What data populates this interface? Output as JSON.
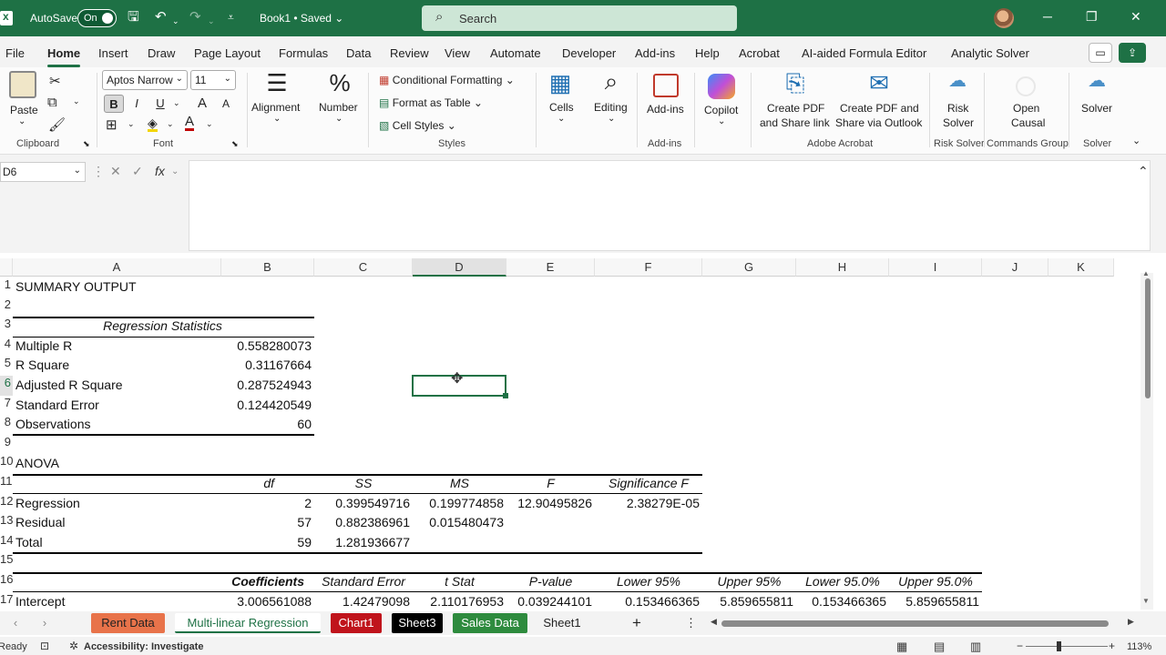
{
  "titlebar": {
    "autosave_label": "AutoSave",
    "toggle_label": "On",
    "doc_title": "Book1 • Saved",
    "search_placeholder": "Search",
    "minimize": "─",
    "restore": "❐",
    "close": "✕"
  },
  "menu": {
    "items": [
      "File",
      "Home",
      "Insert",
      "Draw",
      "Page Layout",
      "Formulas",
      "Data",
      "Review",
      "View",
      "Automate",
      "Developer",
      "Add-ins",
      "Help",
      "Acrobat",
      "AI-aided Formula Editor",
      "Analytic Solver"
    ],
    "active": "Home"
  },
  "ribbon": {
    "paste": "Paste",
    "clipboard": "Clipboard",
    "font_name": "Aptos Narrow",
    "font_size": "11",
    "font": "Font",
    "bold": "B",
    "italic": "I",
    "underline": "U",
    "grow": "A",
    "shrink": "A",
    "alignment": "Alignment",
    "number": "Number",
    "conditional_formatting": "Conditional Formatting",
    "format_as_table": "Format as Table",
    "cell_styles": "Cell Styles",
    "styles": "Styles",
    "cells": "Cells",
    "editing": "Editing",
    "addins": "Add-ins",
    "addins_group": "Add-ins",
    "copilot": "Copilot",
    "create_pdf_share_link_1": "Create PDF",
    "create_pdf_share_link_2": "and Share link",
    "create_pdf_outlook_1": "Create PDF and",
    "create_pdf_outlook_2": "Share via Outlook",
    "adobe_acrobat": "Adobe Acrobat",
    "risk_solver_1": "Risk",
    "risk_solver_2": "Solver",
    "risk_solver_group": "Risk Solver",
    "open_causal_1": "Open",
    "open_causal_2": "Causal",
    "commands_group": "Commands Group",
    "solver": "Solver",
    "solver_group": "Solver"
  },
  "formula_bar": {
    "name_box": "D6",
    "fx": "fx",
    "content": ""
  },
  "columns": [
    "A",
    "B",
    "C",
    "D",
    "E",
    "F",
    "G",
    "H",
    "I",
    "J",
    "K"
  ],
  "selected_column": "D",
  "rows": [
    "1",
    "2",
    "3",
    "4",
    "5",
    "6",
    "7",
    "8",
    "9",
    "10",
    "11",
    "12",
    "13",
    "14",
    "15",
    "16",
    "17"
  ],
  "selected_row": "6",
  "cells": {
    "summary_output": "SUMMARY OUTPUT",
    "regression_statistics": "Regression Statistics",
    "multiple_r_label": "Multiple R",
    "multiple_r": "0.558280073",
    "r_square_label": "R Square",
    "r_square": "0.31167664",
    "adj_r_square_label": "Adjusted R Square",
    "adj_r_square": "0.287524943",
    "std_error_label": "Standard Error",
    "std_error": "0.124420549",
    "observations_label": "Observations",
    "observations": "60",
    "anova": "ANOVA",
    "anova_headers": [
      "df",
      "SS",
      "MS",
      "F",
      "Significance F"
    ],
    "anova_rows": [
      {
        "label": "Regression",
        "df": "2",
        "ss": "0.399549716",
        "ms": "0.199774858",
        "f": "12.90495826",
        "sig": "2.38279E-05"
      },
      {
        "label": "Residual",
        "df": "57",
        "ss": "0.882386961",
        "ms": "0.015480473",
        "f": "",
        "sig": ""
      },
      {
        "label": "Total",
        "df": "59",
        "ss": "1.281936677",
        "ms": "",
        "f": "",
        "sig": ""
      }
    ],
    "coef_headers": [
      "Coefficients",
      "Standard Error",
      "t Stat",
      "P-value",
      "Lower 95%",
      "Upper 95%",
      "Lower 95.0%",
      "Upper 95.0%"
    ],
    "intercept_row": [
      "Intercept",
      "3.006561088",
      "1.42479098",
      "2.110176953",
      "0.039244101",
      "0.153466365",
      "5.859655811",
      "0.153466365",
      "5.859655811"
    ]
  },
  "sheets": [
    {
      "name": "Rent Data",
      "color": "#e8734a",
      "text": "#222"
    },
    {
      "name": "Multi-linear Regression",
      "color": "#ffffff",
      "text": "#1e7145"
    },
    {
      "name": "Chart1",
      "color": "#c0141c",
      "text": "#ffffff"
    },
    {
      "name": "Sheet3",
      "color": "#000000",
      "text": "#ffffff"
    },
    {
      "name": "Sales Data",
      "color": "#2e8b3e",
      "text": "#ffffff"
    },
    {
      "name": "Sheet1",
      "color": "#f3f3f3",
      "text": "#222"
    }
  ],
  "status": {
    "ready": "Ready",
    "accessibility": "Accessibility: Investigate",
    "zoom": "113%"
  },
  "colors": {
    "brand": "#1e7145",
    "search_bg": "#cde6d6"
  }
}
